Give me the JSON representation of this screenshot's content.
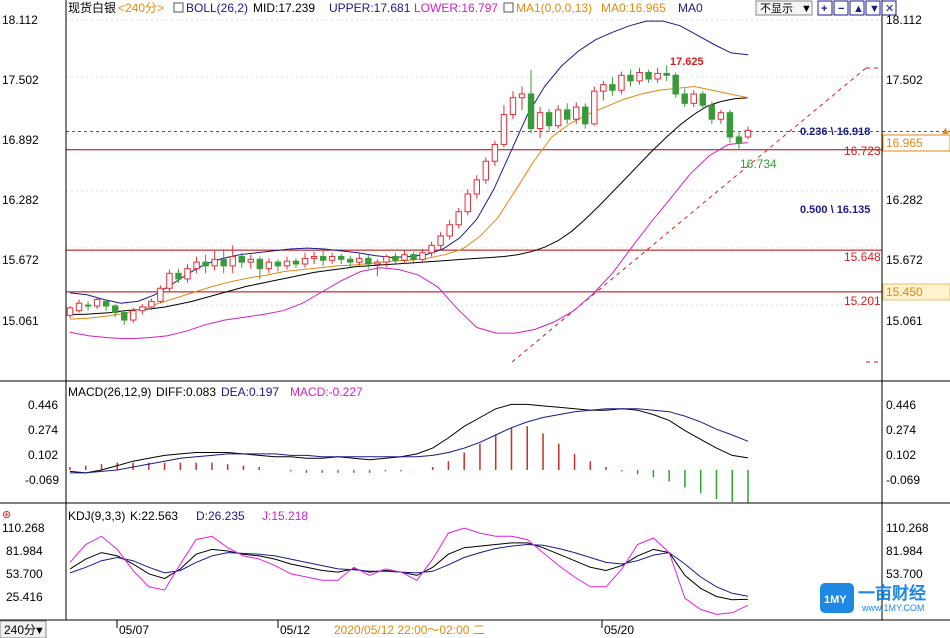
{
  "header": {
    "instrument": "现货白银",
    "period": "<240分>",
    "boll_label": "BOLL(26,2)",
    "boll_mid": "MID:17.239",
    "boll_upper": "UPPER:17.681",
    "boll_lower": "LOWER:16.797",
    "ma_label": "MA1(0,0,0,13)",
    "ma0": "MA0:16.965",
    "ma0_name": "MA0",
    "hide_button": "不显示",
    "icons": [
      "dropdown-icon",
      "add-icon",
      "subtract-icon",
      "up-arrow-icon",
      "down-arrow-icon",
      "close-icon"
    ]
  },
  "main_axis": {
    "ticks": [
      "18.112",
      "17.502",
      "16.892",
      "16.282",
      "15.672",
      "15.061"
    ]
  },
  "annotations": {
    "high": "17.625",
    "low": "16.734",
    "fib_0236": "0.236 \\ 16.918",
    "fib_0500": "0.500 \\ 16.135",
    "line_16723": "16.723",
    "line_15648": "15.648",
    "line_15201": "15.201",
    "tag_ma0": "16.965",
    "tag_lower": "15.450"
  },
  "macd": {
    "label": "MACD(26,12,9)",
    "diff": "DIFF:0.083",
    "dea": "DEA:0.197",
    "macd": "MACD:-0.227",
    "ticks": [
      "0.446",
      "0.274",
      "0.102",
      "-0.069"
    ]
  },
  "kdj": {
    "label": "KDJ(9,3,3)",
    "k": "K:22.563",
    "d": "D:26.235",
    "j": "J:15.218",
    "ticks": [
      "110.268",
      "81.984",
      "53.700",
      "25.416"
    ]
  },
  "bottom": {
    "period_button": "240分",
    "dates": [
      "05/07",
      "05/12",
      "05/20"
    ],
    "cursor_label": "2020/05/12 22:00～02:00 二"
  },
  "logo": {
    "badge": "1MY",
    "name": "一亩财经",
    "url": "www.1MY.COM"
  },
  "colors": {
    "up": "#e0303a",
    "down": "#3a9a3a",
    "boll_mid": "#000000",
    "boll_band": "#1a1a8c",
    "ma0": "#e08a10",
    "lower_band": "#d020c0",
    "hline": "#b00000",
    "fib_line": "#2060d0",
    "trend": "#d02020",
    "diff": "#000000",
    "dea": "#1a1a8c",
    "macd_hist_pos": "#c03030",
    "macd_hist_neg": "#30a030",
    "k": "#000000",
    "d": "#1a1a8c",
    "j": "#e020e0",
    "header_boll": "#1a1a8c",
    "header_lower": "#d020c0",
    "header_ma": "#e08a10"
  },
  "chart_data": [
    {
      "type": "candlestick",
      "title": "现货白银 240分",
      "ylim": [
        14.85,
        18.17
      ],
      "ticks": [
        18.112,
        17.502,
        16.892,
        16.282,
        15.672,
        15.061
      ],
      "x": [
        "05/07",
        "05/12",
        "05/20"
      ],
      "candles": [
        [
          14.95,
          15.03,
          14.92,
          15.05
        ],
        [
          15.0,
          15.08,
          14.98,
          15.12
        ],
        [
          15.06,
          15.05,
          15.0,
          15.1
        ],
        [
          15.05,
          15.12,
          15.02,
          15.14
        ],
        [
          15.1,
          15.05,
          15.0,
          15.12
        ],
        [
          15.05,
          14.98,
          14.93,
          15.07
        ],
        [
          14.98,
          14.9,
          14.85,
          15.01
        ],
        [
          14.9,
          15.0,
          14.87,
          15.03
        ],
        [
          15.0,
          15.04,
          14.96,
          15.07
        ],
        [
          15.04,
          15.1,
          15.01,
          15.13
        ],
        [
          15.1,
          15.24,
          15.08,
          15.27
        ],
        [
          15.24,
          15.4,
          15.2,
          15.44
        ],
        [
          15.4,
          15.34,
          15.3,
          15.45
        ],
        [
          15.34,
          15.45,
          15.3,
          15.5
        ],
        [
          15.45,
          15.52,
          15.4,
          15.58
        ],
        [
          15.52,
          15.48,
          15.4,
          15.6
        ],
        [
          15.48,
          15.55,
          15.43,
          15.64
        ],
        [
          15.55,
          15.48,
          15.4,
          15.66
        ],
        [
          15.48,
          15.58,
          15.4,
          15.7
        ],
        [
          15.58,
          15.52,
          15.46,
          15.62
        ],
        [
          15.52,
          15.55,
          15.45,
          15.6
        ],
        [
          15.55,
          15.45,
          15.34,
          15.58
        ],
        [
          15.45,
          15.52,
          15.4,
          15.56
        ],
        [
          15.52,
          15.48,
          15.42,
          15.55
        ],
        [
          15.48,
          15.53,
          15.44,
          15.58
        ],
        [
          15.53,
          15.5,
          15.46,
          15.56
        ],
        [
          15.5,
          15.56,
          15.46,
          15.62
        ],
        [
          15.56,
          15.58,
          15.5,
          15.63
        ],
        [
          15.58,
          15.54,
          15.48,
          15.64
        ],
        [
          15.54,
          15.58,
          15.5,
          15.62
        ],
        [
          15.58,
          15.55,
          15.5,
          15.61
        ],
        [
          15.55,
          15.52,
          15.47,
          15.59
        ],
        [
          15.52,
          15.56,
          15.48,
          15.62
        ],
        [
          15.56,
          15.5,
          15.45,
          15.6
        ],
        [
          15.5,
          15.52,
          15.37,
          15.55
        ],
        [
          15.52,
          15.58,
          15.47,
          15.6
        ],
        [
          15.58,
          15.54,
          15.5,
          15.62
        ],
        [
          15.54,
          15.6,
          15.5,
          15.64
        ],
        [
          15.6,
          15.55,
          15.5,
          15.63
        ],
        [
          15.55,
          15.62,
          15.52,
          15.66
        ],
        [
          15.62,
          15.7,
          15.58,
          15.74
        ],
        [
          15.7,
          15.8,
          15.66,
          15.84
        ],
        [
          15.8,
          15.92,
          15.76,
          15.97
        ],
        [
          15.92,
          16.06,
          15.88,
          16.1
        ],
        [
          16.06,
          16.25,
          16.02,
          16.3
        ],
        [
          16.25,
          16.4,
          16.2,
          16.45
        ],
        [
          16.4,
          16.6,
          16.36,
          16.64
        ],
        [
          16.6,
          16.78,
          16.55,
          16.82
        ],
        [
          16.78,
          17.1,
          16.75,
          17.2
        ],
        [
          17.1,
          17.28,
          17.05,
          17.35
        ],
        [
          17.28,
          17.32,
          17.15,
          17.4
        ],
        [
          17.32,
          16.95,
          16.9,
          17.58
        ],
        [
          16.95,
          17.12,
          16.85,
          17.18
        ],
        [
          17.12,
          16.98,
          16.92,
          17.16
        ],
        [
          16.98,
          17.15,
          16.95,
          17.2
        ],
        [
          17.15,
          17.05,
          17.0,
          17.22
        ],
        [
          17.05,
          17.18,
          17.0,
          17.23
        ],
        [
          17.18,
          17.0,
          16.95,
          17.22
        ],
        [
          17.0,
          17.35,
          16.98,
          17.4
        ],
        [
          17.35,
          17.42,
          17.25,
          17.46
        ],
        [
          17.42,
          17.36,
          17.3,
          17.5
        ],
        [
          17.36,
          17.52,
          17.32,
          17.56
        ],
        [
          17.52,
          17.46,
          17.4,
          17.58
        ],
        [
          17.46,
          17.55,
          17.42,
          17.6
        ],
        [
          17.55,
          17.48,
          17.44,
          17.58
        ],
        [
          17.48,
          17.54,
          17.44,
          17.6
        ],
        [
          17.54,
          17.52,
          17.46,
          17.625
        ],
        [
          17.52,
          17.32,
          17.28,
          17.55
        ],
        [
          17.32,
          17.22,
          17.18,
          17.38
        ],
        [
          17.22,
          17.32,
          17.18,
          17.36
        ],
        [
          17.32,
          17.2,
          17.15,
          17.35
        ],
        [
          17.2,
          17.05,
          17.0,
          17.24
        ],
        [
          17.05,
          17.12,
          17.0,
          17.15
        ],
        [
          17.12,
          16.86,
          16.8,
          17.15
        ],
        [
          16.86,
          16.8,
          16.734,
          16.92
        ],
        [
          16.86,
          16.93,
          16.84,
          16.97
        ]
      ],
      "series": [
        {
          "name": "MID",
          "values": [
            14.96,
            14.96,
            14.97,
            14.98,
            15.0,
            15.01,
            15.02,
            15.04,
            15.07,
            15.1,
            15.14,
            15.18,
            15.22,
            15.26,
            15.29,
            15.32,
            15.35,
            15.38,
            15.41,
            15.43,
            15.45,
            15.47,
            15.48,
            15.49,
            15.5,
            15.51,
            15.52,
            15.53,
            15.54,
            15.55,
            15.56,
            15.57,
            15.58,
            15.6,
            15.63,
            15.68,
            15.75,
            15.85,
            15.98,
            16.12,
            16.27,
            16.42,
            16.57,
            16.72,
            16.86,
            16.99,
            17.1,
            17.19,
            17.24,
            17.27,
            17.28
          ]
        },
        {
          "name": "UPPER",
          "values": [
            15.19,
            15.17,
            15.12,
            15.08,
            15.1,
            15.17,
            15.28,
            15.4,
            15.5,
            15.56,
            15.6,
            15.62,
            15.64,
            15.66,
            15.67,
            15.66,
            15.64,
            15.62,
            15.59,
            15.57,
            15.58,
            15.6,
            15.66,
            15.78,
            15.98,
            16.3,
            16.7,
            17.1,
            17.4,
            17.62,
            17.78,
            17.9,
            17.98,
            18.05,
            18.1,
            18.1,
            18.05,
            17.95,
            17.85,
            17.76,
            17.74
          ]
        },
        {
          "name": "LOWER",
          "values": [
            14.77,
            14.73,
            14.71,
            14.7,
            14.71,
            14.73,
            14.78,
            14.85,
            14.9,
            14.93,
            14.96,
            15.0,
            15.08,
            15.2,
            15.32,
            15.42,
            15.46,
            15.44,
            15.38,
            15.25,
            15.02,
            14.82,
            14.76,
            14.76,
            14.8,
            14.88,
            15.0,
            15.18,
            15.4,
            15.68,
            15.95,
            16.2,
            16.46,
            16.66,
            16.78,
            16.8
          ]
        },
        {
          "name": "MA0",
          "values": [
            14.91,
            14.92,
            14.94,
            14.97,
            15.02,
            15.08,
            15.14,
            15.2,
            15.26,
            15.31,
            15.35,
            15.38,
            15.42,
            15.44,
            15.46,
            15.48,
            15.49,
            15.51,
            15.53,
            15.54,
            15.56,
            15.6,
            15.66,
            15.8,
            16.0,
            16.3,
            16.6,
            16.86,
            17.0,
            17.1,
            17.18,
            17.26,
            17.32,
            17.36,
            17.38,
            17.4,
            17.36,
            17.32,
            17.28
          ]
        }
      ],
      "hlines": [
        16.918,
        16.723,
        15.648,
        15.201
      ],
      "fib_levels": [
        {
          "ratio": 0.236,
          "price": 16.918
        },
        {
          "ratio": 0.5,
          "price": 16.135
        }
      ]
    },
    {
      "type": "bar+line",
      "title": "MACD(26,12,9)",
      "ylim": [
        -0.16,
        0.52
      ],
      "ticks": [
        0.446,
        0.274,
        0.102,
        -0.069
      ],
      "series": [
        {
          "name": "DIFF",
          "values": [
            -0.01,
            -0.02,
            0.0,
            0.03,
            0.06,
            0.08,
            0.1,
            0.11,
            0.12,
            0.12,
            0.12,
            0.11,
            0.1,
            0.09,
            0.09,
            0.08,
            0.08,
            0.09,
            0.08,
            0.07,
            0.08,
            0.09,
            0.11,
            0.15,
            0.22,
            0.3,
            0.36,
            0.42,
            0.45,
            0.45,
            0.44,
            0.43,
            0.42,
            0.41,
            0.41,
            0.42,
            0.41,
            0.38,
            0.34,
            0.27,
            0.21,
            0.15,
            0.1,
            0.083
          ]
        },
        {
          "name": "DEA",
          "values": [
            -0.02,
            -0.02,
            -0.01,
            0.0,
            0.02,
            0.04,
            0.06,
            0.08,
            0.09,
            0.1,
            0.11,
            0.11,
            0.11,
            0.11,
            0.1,
            0.1,
            0.09,
            0.09,
            0.09,
            0.09,
            0.09,
            0.09,
            0.09,
            0.1,
            0.12,
            0.15,
            0.19,
            0.24,
            0.29,
            0.33,
            0.36,
            0.38,
            0.4,
            0.41,
            0.42,
            0.42,
            0.42,
            0.41,
            0.4,
            0.37,
            0.33,
            0.28,
            0.24,
            0.197
          ]
        },
        {
          "name": "MACD",
          "values": [
            0.02,
            0.03,
            0.04,
            0.05,
            0.05,
            0.05,
            0.05,
            0.05,
            0.05,
            0.05,
            0.04,
            0.03,
            0.02,
            0.0,
            -0.01,
            -0.02,
            -0.02,
            -0.02,
            -0.02,
            -0.02,
            -0.01,
            -0.01,
            0.0,
            0.02,
            0.06,
            0.12,
            0.18,
            0.24,
            0.29,
            0.3,
            0.25,
            0.18,
            0.11,
            0.06,
            0.02,
            -0.01,
            -0.03,
            -0.05,
            -0.08,
            -0.12,
            -0.16,
            -0.2,
            -0.22,
            -0.227
          ]
        }
      ]
    },
    {
      "type": "line",
      "title": "KDJ(9,3,3)",
      "ylim": [
        5,
        125
      ],
      "ticks": [
        110.268,
        81.984,
        53.7,
        25.416
      ],
      "series": [
        {
          "name": "K",
          "values": [
            60,
            72,
            80,
            76,
            66,
            54,
            48,
            60,
            78,
            84,
            82,
            78,
            76,
            72,
            66,
            62,
            58,
            56,
            60,
            56,
            58,
            56,
            52,
            62,
            78,
            86,
            88,
            90,
            92,
            92,
            86,
            78,
            70,
            62,
            58,
            64,
            76,
            84,
            80,
            52,
            36,
            26,
            22,
            22.563
          ]
        },
        {
          "name": "D",
          "values": [
            55,
            62,
            70,
            74,
            70,
            62,
            55,
            58,
            68,
            76,
            80,
            79,
            78,
            76,
            72,
            68,
            64,
            60,
            59,
            57,
            57,
            56,
            55,
            57,
            65,
            74,
            80,
            85,
            88,
            90,
            89,
            85,
            80,
            74,
            68,
            66,
            70,
            77,
            80,
            66,
            50,
            38,
            30,
            26.235
          ]
        },
        {
          "name": "J",
          "values": [
            68,
            90,
            100,
            84,
            58,
            38,
            34,
            66,
            96,
            100,
            86,
            76,
            72,
            64,
            54,
            50,
            46,
            46,
            62,
            52,
            60,
            56,
            46,
            72,
            104,
            110,
            104,
            100,
            100,
            96,
            80,
            64,
            50,
            38,
            38,
            60,
            90,
            98,
            80,
            24,
            10,
            4,
            6,
            15.218
          ]
        }
      ]
    }
  ]
}
